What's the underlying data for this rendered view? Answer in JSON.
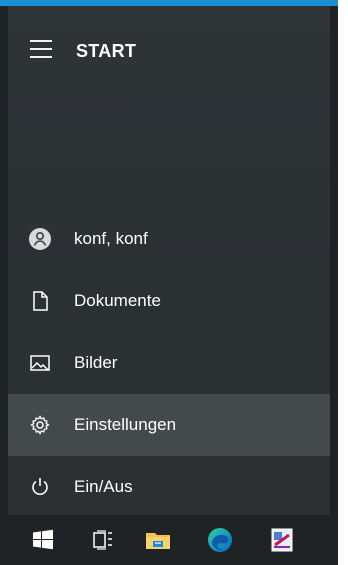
{
  "window": {
    "accent_color": "#1b8fd6"
  },
  "header": {
    "title": "START",
    "menu_icon": "hamburger-icon"
  },
  "menu": {
    "items": [
      {
        "label": "konf, konf",
        "icon": "user-avatar-icon"
      },
      {
        "label": "Dokumente",
        "icon": "document-icon"
      },
      {
        "label": "Bilder",
        "icon": "pictures-icon"
      },
      {
        "label": "Einstellungen",
        "icon": "gear-icon",
        "highlighted": true
      },
      {
        "label": "Ein/Aus",
        "icon": "power-icon"
      }
    ]
  },
  "taskbar": {
    "items": [
      {
        "icon": "windows-logo-icon"
      },
      {
        "icon": "task-view-icon"
      },
      {
        "icon": "file-explorer-icon"
      },
      {
        "icon": "edge-browser-icon"
      },
      {
        "icon": "paint-app-icon"
      }
    ]
  }
}
